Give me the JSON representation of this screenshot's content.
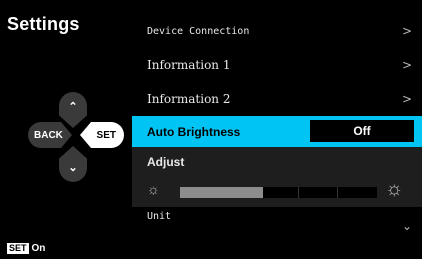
{
  "title": "Settings",
  "controls": {
    "up_icon": "chevron-up-icon",
    "down_icon": "chevron-down-icon",
    "back_label": "BACK",
    "set_label": "SET"
  },
  "footer": {
    "badge": "SET",
    "text": "On"
  },
  "menu": {
    "items": [
      {
        "label": "Device Connection",
        "arrow": ">"
      },
      {
        "label": "Information 1",
        "arrow": ">"
      },
      {
        "label": "Information 2",
        "arrow": ">"
      }
    ],
    "active": {
      "label": "Auto Brightness",
      "value": "Off"
    },
    "adjust": {
      "label": "Adjust",
      "level": 0.42,
      "segments": 5
    },
    "unit": {
      "label": "Unit",
      "arrow": "⌄"
    }
  },
  "colors": {
    "highlight": "#00c4f4"
  }
}
